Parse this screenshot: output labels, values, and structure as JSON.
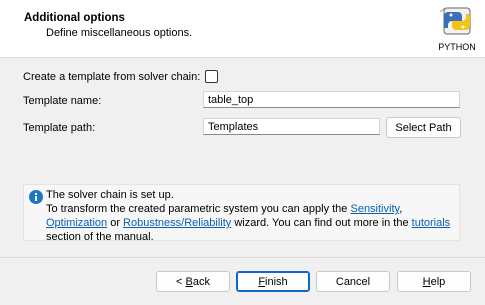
{
  "header": {
    "title": "Additional options",
    "subtitle": "Define miscellaneous options.",
    "logo_label": "PYTHON"
  },
  "form": {
    "template_from_chain_label": "Create a template from solver chain:",
    "template_from_chain_checked": false,
    "template_name_label": "Template name:",
    "template_name_value": "table_top",
    "template_path_label": "Template path:",
    "template_path_value": "Templates",
    "select_path_button": "Select Path"
  },
  "info": {
    "line1": "The solver chain is set up.",
    "line2_prefix": "To transform the created parametric system you can apply the ",
    "link_sensitivity": "Sensitivity",
    "comma1": ",",
    "link_optimization": "Optimization",
    "or_text": " or ",
    "link_robustness": "Robustness/Reliability",
    "line3_mid": " wizard. You can find out more in the ",
    "link_tutorials": "tutorials",
    "line4": "section of the manual."
  },
  "buttons": {
    "back_prefix": "< ",
    "back_mnemonic": "B",
    "back_rest": "ack",
    "finish_mnemonic": "F",
    "finish_rest": "inish",
    "cancel": "Cancel",
    "help_mnemonic": "H",
    "help_rest": "elp"
  },
  "colors": {
    "accent": "#0f67c8",
    "link": "#0b5fb3",
    "info_icon": "#1f73c9"
  }
}
